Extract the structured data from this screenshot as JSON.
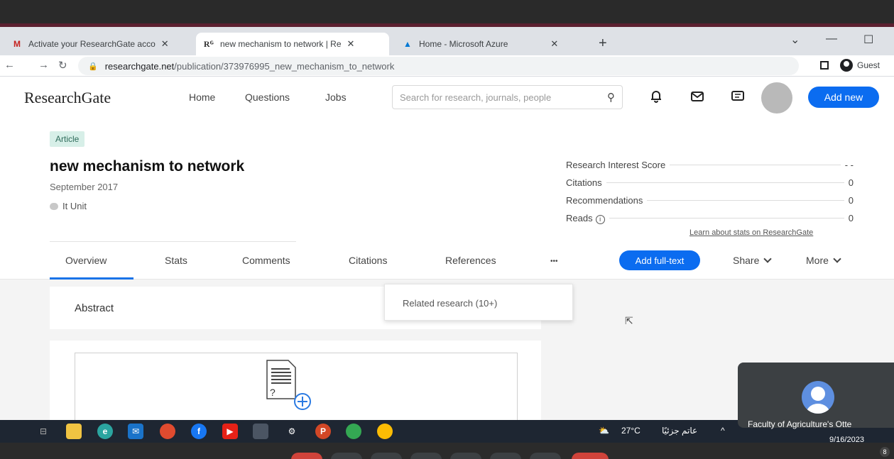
{
  "browser": {
    "tabs": [
      {
        "title": "Activate your ResearchGate acco",
        "favicon": "gmail-icon"
      },
      {
        "title": "new mechanism to network | Re",
        "favicon": "researchgate-icon"
      },
      {
        "title": "Home - Microsoft Azure",
        "favicon": "azure-icon"
      }
    ],
    "new_tab": "+",
    "url_host": "researchgate.net",
    "url_path": "/publication/373976995_new_mechanism_to_network",
    "profile_label": "Guest"
  },
  "header": {
    "logo": "ResearchGate",
    "nav": [
      "Home",
      "Questions",
      "Jobs"
    ],
    "search_placeholder": "Search for research, journals, people",
    "add_new": "Add new"
  },
  "article": {
    "badge": "Article",
    "title": "new mechanism to network",
    "date": "September 2017",
    "author": "It Unit"
  },
  "stats": {
    "rows": [
      {
        "label": "Research Interest Score",
        "value": "- -"
      },
      {
        "label": "Citations",
        "value": "0"
      },
      {
        "label": "Recommendations",
        "value": "0"
      },
      {
        "label": "Reads",
        "value": "0"
      }
    ],
    "learn_link": "Learn about stats on ResearchGate"
  },
  "tabs": {
    "items": [
      "Overview",
      "Stats",
      "Comments",
      "Citations",
      "References"
    ],
    "more_dots": "•••",
    "add_full_text": "Add full-text",
    "share": "Share",
    "more": "More"
  },
  "dropdown": {
    "item": "Related research (10+)"
  },
  "abstract": {
    "label": "Abstract"
  },
  "taskbar": {
    "weather": "27°C",
    "weather_text": "عاتم جزئيًا",
    "date": "9/16/2023"
  },
  "video": {
    "name": "Faculty of Agriculture's Otte"
  },
  "badge": "8",
  "colors": {
    "accent": "#0b6cf0",
    "badge_bg": "#d7efe8",
    "taskbar": "#1e2632"
  }
}
